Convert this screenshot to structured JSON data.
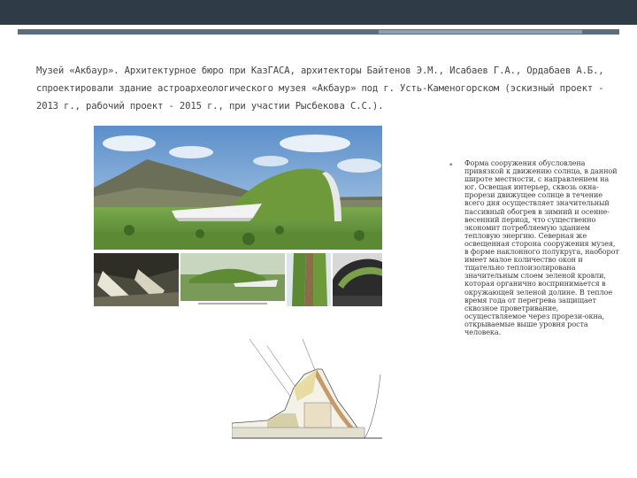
{
  "slide": {
    "title": "Музей «Акбаур». Архитектурное бюро при КазГАСА, архитекторы Байтенов Э.М., Исабаев Г.А., Ордабаев А.Б., спроектировали здание астроархеологического музея «Акбаур» под г. Усть-Каменогорском (эскизный проект - 2013 г., рабочий проект - 2015 г., при участии Рысбекова С.С.).",
    "bullet_marker": "•",
    "description": "Форма сооружения обусловлена привязкой к движению солнца, в данной широте местности, с направлением на юг. Освещая интерьер, сквозь окна- прорези движущее солнце в течение всего дня осуществляет значительный пассивный обогрев в зимний и осенне-весенний период, что существенно экономит потребляемую зданием тепловую энергию. Северная же освещенная сторона сооружения музея, в форме наклонного полукруга, наоборот имеет малое количество окон и тщательно теплоизолирована значительным слоем зеленой кровли, которая органично воспринимается в окружающей зеленой долине. В теплое время года от перегрева защищает сквозное проветривание, осуществляемое через прорези-окна, открываемые выше уровня роста человека."
  },
  "colors": {
    "topbar": "#2f3c48",
    "accent": "#5a6e80",
    "accent_light": "#8da1b3",
    "sky": "#6f9fd2",
    "grass": "#5f8f3a",
    "mountain": "#6b6f58"
  },
  "images": [
    {
      "name": "hero-render"
    },
    {
      "name": "interior-render"
    },
    {
      "name": "site-model"
    },
    {
      "name": "green-roof-detail"
    },
    {
      "name": "window-slot-detail"
    },
    {
      "name": "section-drawing"
    }
  ]
}
